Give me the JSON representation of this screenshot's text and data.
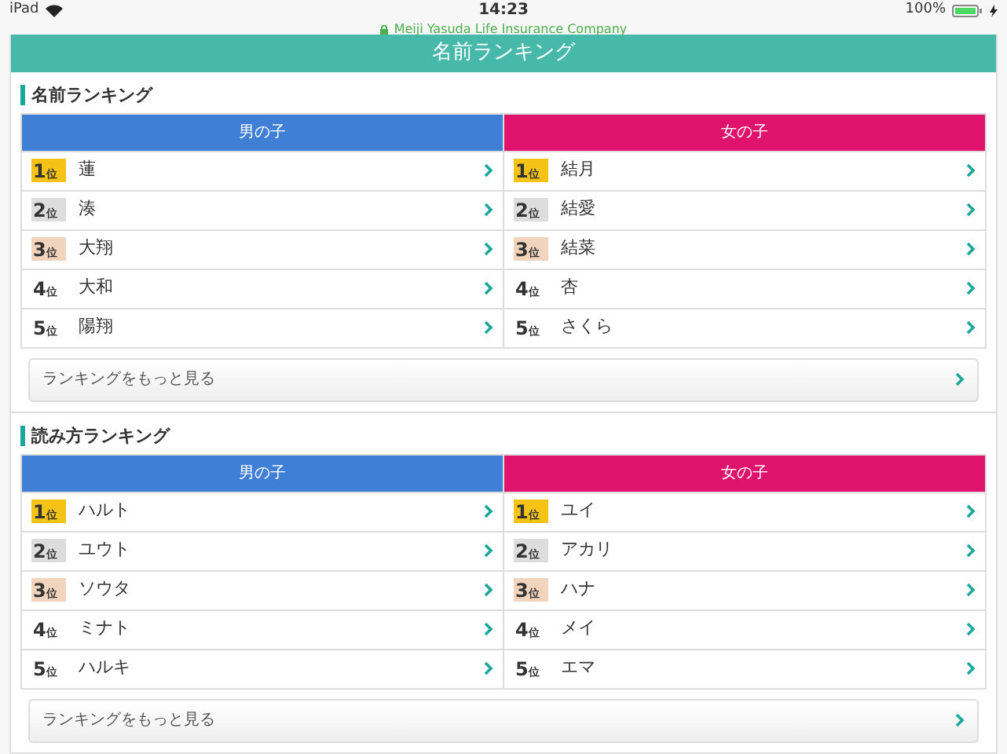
{
  "status_bar": {
    "device": "iPad",
    "time": "14:23",
    "battery": "100%",
    "address": "Meiji Yasuda Life Insurance Company"
  },
  "page_title": "名前ランキング",
  "sections": [
    {
      "title": "名前ランキング",
      "columns": [
        {
          "heading": "男の子",
          "color": "#3f80d6",
          "rows": [
            {
              "rank": "1$_{位}$",
              "color": "#f4c316",
              "name": "蓮"
            },
            {
              "rank": "2$_{位}$",
              "color": "#dddddd",
              "name": "湊"
            },
            {
              "rank": "3$_{位}$",
              "color": "#f2d4bd",
              "name": "大翔"
            },
            {
              "rank": "4$_{位}$",
              "name": "大和"
            },
            {
              "rank": "5$_{位}$",
              "name": "陽翔"
            }
          ]
        },
        {
          "heading": "女の子",
          "color": "#df136c",
          "rows": [
            {
              "rank": "1$_{位}$",
              "color": "#f4c316",
              "name": "結月"
            },
            {
              "rank": "2$_{位}$",
              "color": "#dddddd",
              "name": "結愛"
            },
            {
              "rank": "3$_{位}$",
              "color": "#f2d4bd",
              "name": "結菜"
            },
            {
              "rank": "4$_{位}$",
              "name": "杏"
            },
            {
              "rank": "5$_{位}$",
              "name": "さくら"
            }
          ]
        }
      ],
      "more_button": "ランキングをもっと見る"
    },
    {
      "title": "読み方ランキング",
      "columns": [
        {
          "heading": "男の子",
          "color": "#3f80d6",
          "rows": [
            {
              "rank": "1$_{位}$",
              "color": "#f4c316",
              "name": "ハルト"
            },
            {
              "rank": "2$_{位}$",
              "color": "#dddddd",
              "name": "ユウト"
            },
            {
              "rank": "3$_{位}$",
              "color": "#f2d4bd",
              "name": "ソウタ"
            },
            {
              "rank": "4$_{位}$",
              "name": "ミナト"
            },
            {
              "rank": "5$_{位}$",
              "name": "ハルキ"
            }
          ]
        },
        {
          "heading": "女の子",
          "color": "#df136c",
          "rows": [
            {
              "rank": "1$_{位}$",
              "color": "#f4c316",
              "name": "ユイ"
            },
            {
              "rank": "2$_{位}$",
              "color": "#dddddd",
              "name": "アカリ"
            },
            {
              "rank": "3$_{位}$",
              "color": "#f2d4bd",
              "name": "ハナ"
            },
            {
              "rank": "4$_{位}$",
              "name": "メイ"
            },
            {
              "rank": "5$_{位}$",
              "name": "エマ"
            }
          ]
        }
      ],
      "more_button": "ランキングをもっと見る"
    }
  ]
}
